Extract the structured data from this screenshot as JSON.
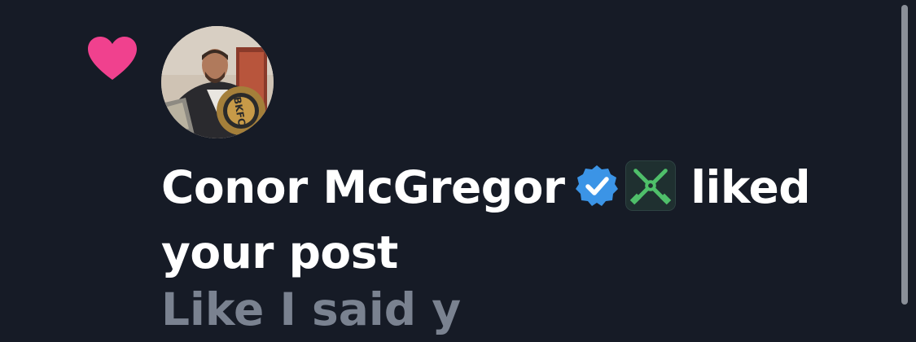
{
  "notification": {
    "type_icon": "heart-icon",
    "avatar_alt": "Conor McGregor avatar",
    "user_name": "Conor McGregor",
    "verified_icon": "verified-badge-icon",
    "affiliate_icon": "affiliate-badge-icon",
    "action_text": " liked your post",
    "post_preview": "Like I said y"
  },
  "colors": {
    "background": "#161b26",
    "heart": "#f0418e",
    "verified": "#3b94e6",
    "text": "#ffffff",
    "muted_text": "#7a8290"
  }
}
